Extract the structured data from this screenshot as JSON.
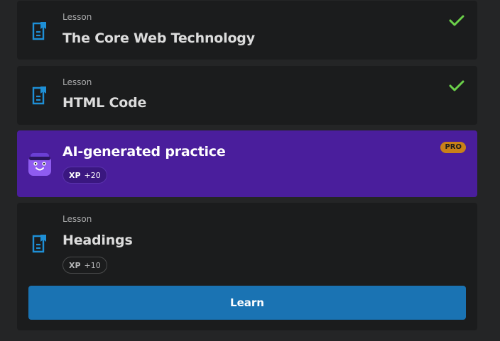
{
  "lessons": [
    {
      "kicker": "Lesson",
      "title": "The Core Web Technology",
      "completed": true,
      "icon": "lesson-document-icon"
    },
    {
      "kicker": "Lesson",
      "title": "HTML Code",
      "completed": true,
      "icon": "lesson-document-icon"
    }
  ],
  "ai_practice": {
    "title": "AI-generated practice",
    "xp_label": "XP",
    "xp_value": "+20",
    "badge": "PRO",
    "icon": "ai-bot-avatar-icon"
  },
  "current_lesson": {
    "kicker": "Lesson",
    "title": "Headings",
    "xp_label": "XP",
    "xp_value": "+10",
    "button_label": "Learn",
    "icon": "lesson-document-icon"
  },
  "colors": {
    "background": "#242526",
    "card": "#1b1c1d",
    "ai_card": "#4a1e9c",
    "accent_blue": "#1a73b3",
    "icon_blue": "#1e8fd6",
    "check_green": "#6bd04a",
    "pro_orange": "#c98118"
  }
}
